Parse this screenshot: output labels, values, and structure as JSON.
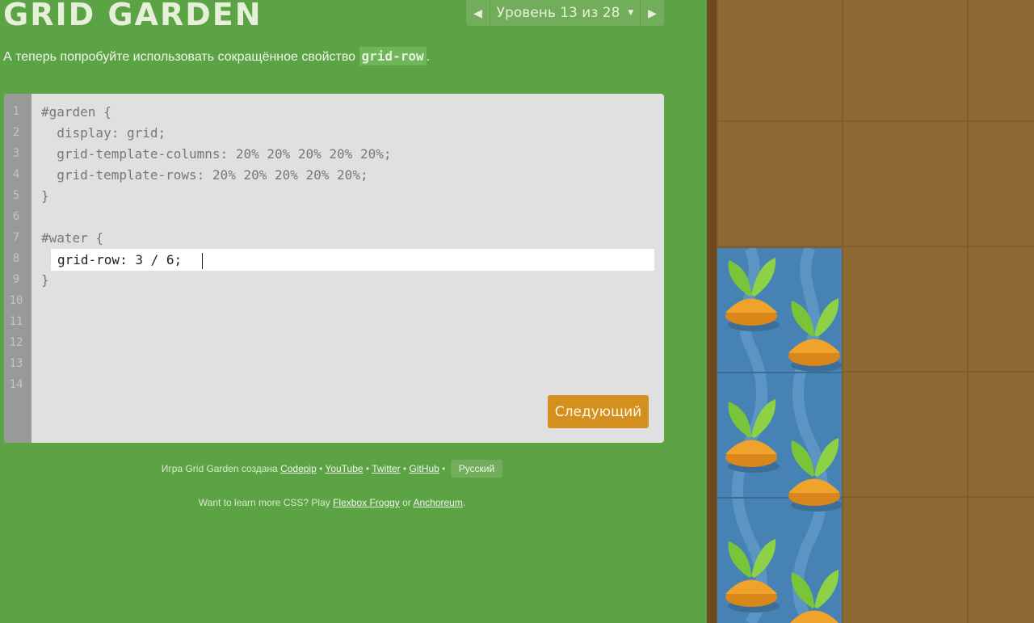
{
  "header": {
    "title": "GRID GARDEN",
    "level_indicator": "Уровень 13 из 28",
    "dropdown_icon": "triangle-down-icon",
    "prev_icon": "arrow-left-icon",
    "next_icon": "arrow-right-icon"
  },
  "instructions": {
    "text": "А теперь попробуйте использовать сокращённое свойство ",
    "code": "grid-row",
    "end": "."
  },
  "editor": {
    "line_numbers": [
      "1",
      "2",
      "3",
      "4",
      "5",
      "6",
      "7",
      "8",
      "9",
      "10",
      "11",
      "12",
      "13",
      "14"
    ],
    "lines_before": [
      "#garden {",
      "  display: grid;",
      "  grid-template-columns: 20% 20% 20% 20% 20%;",
      "  grid-template-rows: 20% 20% 20% 20% 20%;",
      "}",
      "",
      "#water {"
    ],
    "input_value": "grid-row: 3 / 6;",
    "line_after": "}",
    "next_button": "Следующий"
  },
  "credits": {
    "prefix": "Игра Grid Garden создана ",
    "links": [
      "Codepip",
      "YouTube",
      "Twitter",
      "GitHub"
    ],
    "separator": " • ",
    "language": "Русский"
  },
  "more": {
    "prefix": "Want to learn more CSS? Play ",
    "link1": "Flexbox Froggy",
    "middle": " or ",
    "link2": "Anchoreum",
    "end": "."
  },
  "garden": {
    "water_rows": "3 / 6",
    "plant_icon": "carrot-sprout-icon"
  },
  "colors": {
    "background": "#5ca345",
    "soil": "#8d6a33",
    "water": "#4682b4",
    "button": "#d4901f"
  }
}
